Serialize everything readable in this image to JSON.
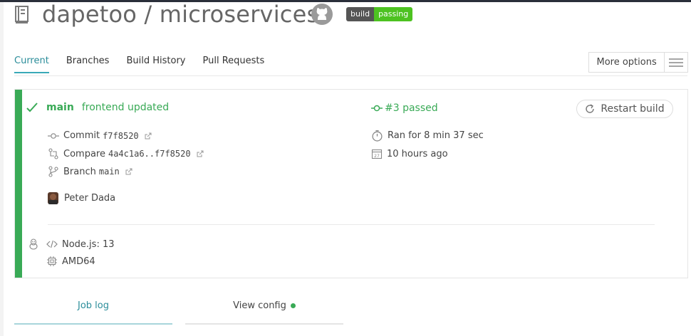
{
  "header": {
    "repo_title": "dapetoo / microservices",
    "badge_left": "build",
    "badge_right": "passing"
  },
  "tabs": [
    {
      "label": "Current"
    },
    {
      "label": "Branches"
    },
    {
      "label": "Build History"
    },
    {
      "label": "Pull Requests"
    }
  ],
  "more_options_label": "More options",
  "build": {
    "branch": "main",
    "message": "frontend updated",
    "status": "#3 passed",
    "restart_label": "Restart build",
    "commit_label": "Commit",
    "commit_hash": "f7f8520",
    "compare_label": "Compare",
    "compare_range": "4a4c1a6..f7f8520",
    "branch_label": "Branch",
    "branch_name": "main",
    "author": "Peter Dada",
    "duration": "Ran for 8 min 37 sec",
    "finished": "10 hours ago",
    "language": "Node.js: 13",
    "arch": "AMD64"
  },
  "bottom_tabs": {
    "job_log": "Job log",
    "view_config": "View config"
  },
  "colors": {
    "passed": "#39aa56",
    "accent": "#3aa9b8",
    "badge_green": "#4dc221"
  }
}
